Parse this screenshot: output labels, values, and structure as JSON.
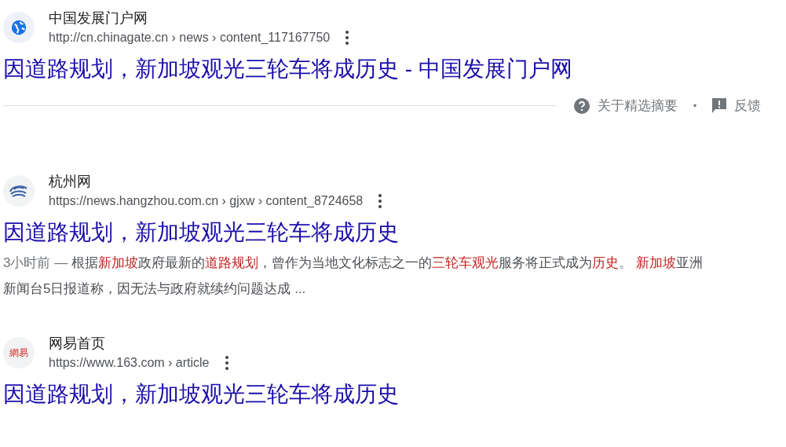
{
  "results": [
    {
      "site": "中国发展门户网",
      "url": "http://cn.chinagate.cn › news › content_117167750",
      "favicon": {
        "kind": "globe"
      },
      "title": "因道路规划，新加坡观光三轮车将成历史 - 中国发展门户网",
      "footer": {
        "about": "关于精选摘要",
        "separator": "•",
        "feedback": "反馈"
      }
    },
    {
      "site": "杭州网",
      "url": "https://news.hangzhou.com.cn › gjxw › content_8724658",
      "favicon": {
        "kind": "swirl"
      },
      "title": "因道路规划，新加坡观光三轮车将成历史",
      "snippet": [
        {
          "text": "3小时前 — ",
          "highlight": false,
          "kind": "date"
        },
        {
          "text": "根据",
          "highlight": false
        },
        {
          "text": "新加坡",
          "highlight": true
        },
        {
          "text": "政府最新的",
          "highlight": false
        },
        {
          "text": "道路规划",
          "highlight": true
        },
        {
          "text": "，曾作为当地文化标志之一的",
          "highlight": false
        },
        {
          "text": "三轮车观光",
          "highlight": true
        },
        {
          "text": "服务将正式成为",
          "highlight": false
        },
        {
          "text": "历史",
          "highlight": true
        },
        {
          "text": "。 ",
          "highlight": false
        },
        {
          "text": "新加坡",
          "highlight": true
        },
        {
          "text": "亚洲新闻台5日报道称，因无法与政府就续约问题达成 ...",
          "highlight": false
        }
      ]
    },
    {
      "site": "网易首页",
      "url": "https://www.163.com › article",
      "favicon": {
        "kind": "text",
        "text": "網易"
      },
      "title": "因道路规划，新加坡观光三轮车将成历史"
    }
  ]
}
